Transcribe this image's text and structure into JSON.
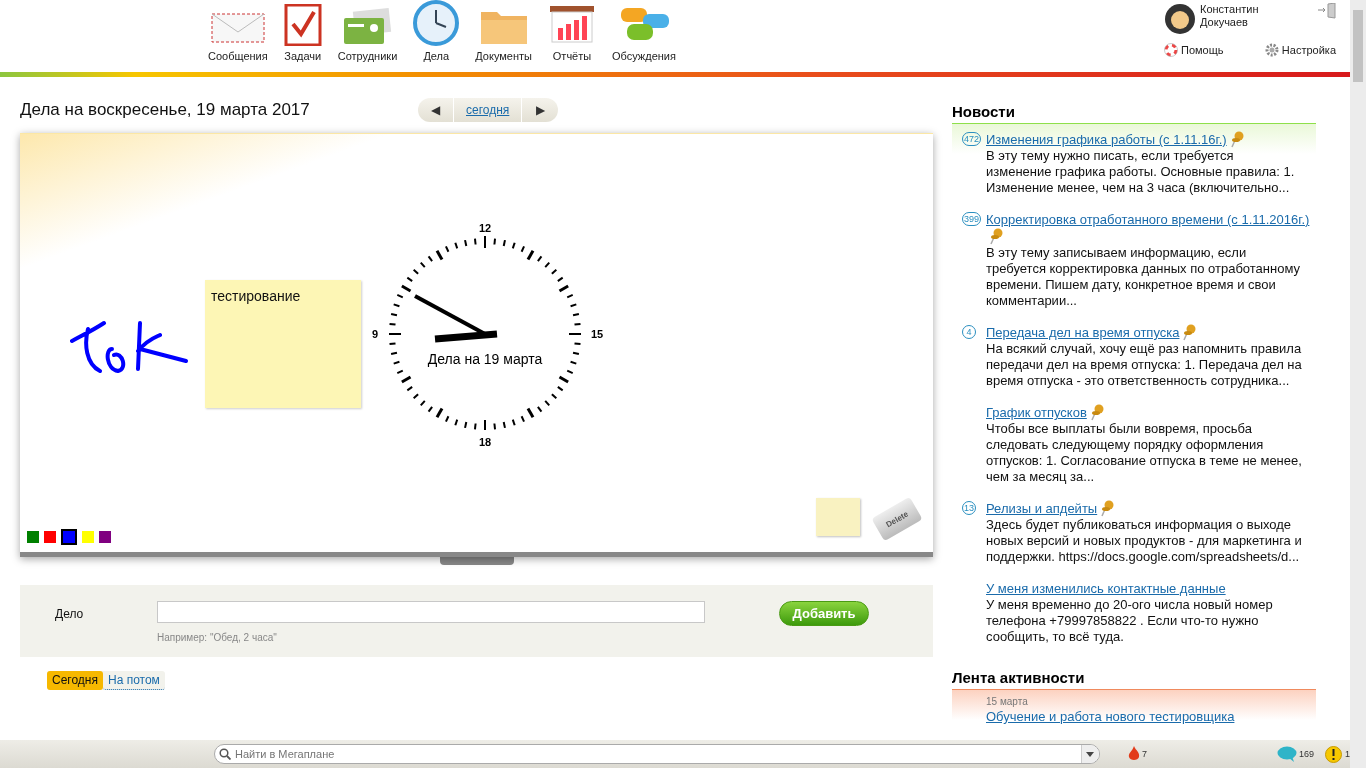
{
  "nav": [
    {
      "label": "Сообщения"
    },
    {
      "label": "Задачи"
    },
    {
      "label": "Сотрудники"
    },
    {
      "label": "Дела"
    },
    {
      "label": "Документы"
    },
    {
      "label": "Отчёты"
    },
    {
      "label": "Обсуждения"
    }
  ],
  "user": {
    "name": "Константин Докучаев"
  },
  "header_links": [
    "Помощь",
    "Настройка"
  ],
  "day": {
    "title": "Дела на воскресенье, 19 марта 2017",
    "today_link": "сегодня",
    "prev": "◀",
    "next": "▶"
  },
  "board": {
    "sticky_note": "тестирование",
    "clock": {
      "labels": [
        "12",
        "15",
        "18",
        "9"
      ],
      "caption": "Дела на 19 марта"
    },
    "palette": [
      {
        "color": "#008000",
        "selected": false
      },
      {
        "color": "#ff0000",
        "selected": false
      },
      {
        "color": "#0000ff",
        "selected": true
      },
      {
        "color": "#ffff00",
        "selected": false
      },
      {
        "color": "#800080",
        "selected": false
      }
    ],
    "eraser_label": "Delete"
  },
  "form": {
    "label": "Дело",
    "hint": "Например: \"Обед, 2 часа\"",
    "button": "Добавить"
  },
  "filters": [
    {
      "label": "Сегодня",
      "selected": true
    },
    {
      "label": "На потом",
      "selected": false
    }
  ],
  "news": {
    "title": "Новости",
    "items": [
      {
        "count": "472",
        "title": "Изменения графика работы (с 1.11.16г.)",
        "pinned": true,
        "text": "В эту тему нужно писать, если требуется изменение графика работы. Основные правила: 1. Изменение менее, чем на 3 часа (включительно..."
      },
      {
        "count": "399",
        "title": "Корректировка отработанного времени (с 1.11.2016г.)",
        "pinned": true,
        "text": "В эту тему записываем информацию, если требуется корректировка данных по отработанному времени. Пишем дату, конкретное время и свои комментарии..."
      },
      {
        "count": "4",
        "title": "Передача дел на время отпуска",
        "pinned": true,
        "text": "На всякий случай, хочу ещё раз напомнить правила передачи дел на время отпуска: 1. Передача дел на время отпуска - это ответственность сотрудника..."
      },
      {
        "title": "График отпусков",
        "pinned": true,
        "text": "Чтобы все выплаты были вовремя, просьба следовать следующему порядку оформления отпусков: 1. Согласование отпуска в теме не менее, чем за месяц за..."
      },
      {
        "count": "13",
        "title": "Релизы и апдейты",
        "pinned": true,
        "text": "Здесь будет публиковаться информация о выходе новых версий и новых продуктов - для маркетинга и поддержки. https://docs.google.com/spreadsheets/d..."
      },
      {
        "title": "У меня изменились контактные данные",
        "pinned": false,
        "text": "У меня временно до 20-ого числа новый номер телефона +79997858822 . Если что-то нужно сообщить, то всё туда."
      }
    ]
  },
  "activity": {
    "title": "Лента активности",
    "items": [
      {
        "date": "15 марта",
        "title": "Обучение и работа нового тестировщика"
      }
    ]
  },
  "bottom_bar": {
    "search_placeholder": "Найти в Мегаплане",
    "badges": [
      {
        "kind": "fire",
        "count": "7"
      },
      {
        "kind": "chat",
        "count": "169"
      },
      {
        "kind": "warning",
        "count": "1"
      }
    ]
  }
}
